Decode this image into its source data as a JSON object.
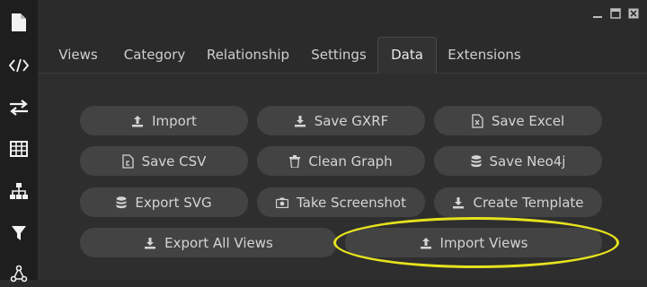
{
  "sidebar": {
    "items": [
      {
        "icon": "file-icon"
      },
      {
        "icon": "code-icon"
      },
      {
        "icon": "swap-arrows-icon"
      },
      {
        "icon": "table-icon"
      },
      {
        "icon": "hierarchy-icon"
      },
      {
        "icon": "filter-icon"
      },
      {
        "icon": "network-icon"
      }
    ]
  },
  "window": {
    "controls": [
      "minimize",
      "maximize",
      "close"
    ]
  },
  "tabs": [
    {
      "label": "Views",
      "active": false
    },
    {
      "label": "Category",
      "active": false
    },
    {
      "label": "Relationship",
      "active": false
    },
    {
      "label": "Settings",
      "active": false
    },
    {
      "label": "Data",
      "active": true
    },
    {
      "label": "Extensions",
      "active": false
    }
  ],
  "data_panel": {
    "buttons": [
      {
        "label": "Import",
        "icon": "upload-icon"
      },
      {
        "label": "Save GXRF",
        "icon": "download-icon"
      },
      {
        "label": "Save Excel",
        "icon": "excel-file-icon"
      },
      {
        "label": "Save CSV",
        "icon": "csv-file-icon"
      },
      {
        "label": "Clean Graph",
        "icon": "trash-icon"
      },
      {
        "label": "Save Neo4j",
        "icon": "database-icon"
      },
      {
        "label": "Export SVG",
        "icon": "database-icon"
      },
      {
        "label": "Take Screenshot",
        "icon": "camera-icon"
      },
      {
        "label": "Create Template",
        "icon": "download-icon"
      },
      {
        "label": "Export All Views",
        "icon": "download-icon"
      },
      {
        "label": "Import Views",
        "icon": "upload-icon"
      }
    ],
    "highlight_color": "#e6e21e",
    "highlighted_button": "Import Views"
  },
  "colors": {
    "background": "#2b2b2b",
    "sidebar": "#1e1e1e",
    "button": "#434343",
    "text": "#d4d4d4"
  }
}
